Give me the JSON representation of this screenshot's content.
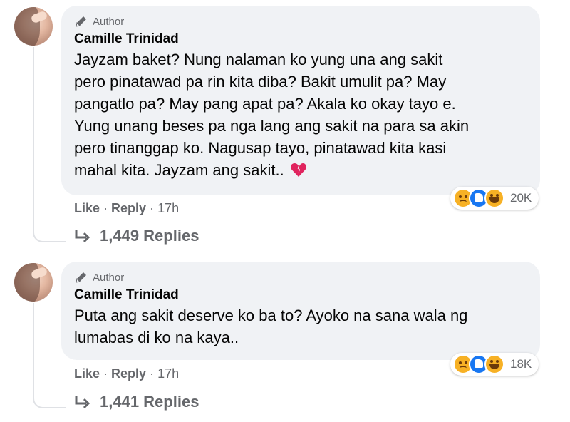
{
  "comments": [
    {
      "badge": "Author",
      "name": "Camille Trinidad",
      "text": "Jayzam baket? Nung nalaman ko yung una ang sakit\npero pinatawad pa rin kita diba? Bakit umulit pa? May\npangatlo pa? May pang apat pa? Akala ko okay tayo e.\nYung unang beses pa nga lang ang sakit na para sa akin\npero tinanggap ko. Nagusap tayo, pinatawad kita kasi\nmahal kita. Jayzam ang sakit..",
      "emoji_icon": "broken-heart-icon",
      "reaction_icons": [
        "sad-icon",
        "like-icon",
        "haha-icon"
      ],
      "reaction_count": "20K",
      "like_label": "Like",
      "reply_label": "Reply",
      "separator": "·",
      "time": "17h",
      "replies_label": "1,449 Replies"
    },
    {
      "badge": "Author",
      "name": "Camille Trinidad",
      "text": "Puta ang sakit deserve ko ba to? Ayoko na sana wala ng\nlumabas di ko na kaya..",
      "reaction_icons": [
        "sad-icon",
        "like-icon",
        "haha-icon"
      ],
      "reaction_count": "18K",
      "like_label": "Like",
      "reply_label": "Reply",
      "separator": "·",
      "time": "17h",
      "replies_label": "1,441 Replies"
    }
  ],
  "colors": {
    "bubble": "#f0f2f5",
    "secondary_text": "#65676b",
    "primary_text": "#050505",
    "like_blue": "#1877f2",
    "broken_heart": "#e0245e"
  }
}
